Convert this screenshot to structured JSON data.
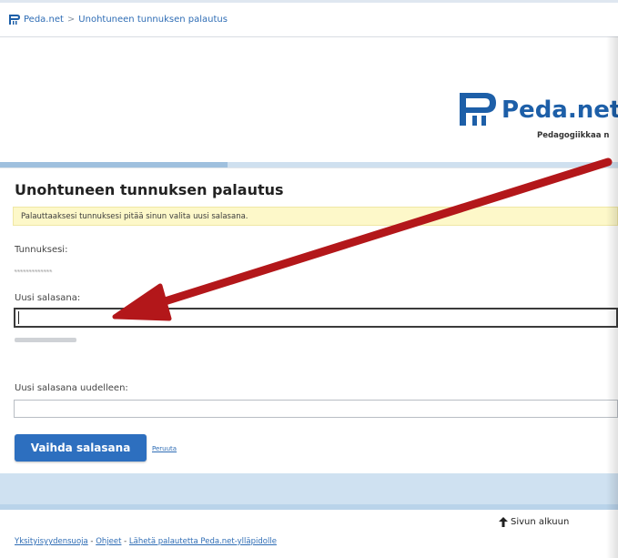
{
  "breadcrumb": {
    "site": "Peda.net",
    "separator": ">",
    "current": "Unohtuneen tunnuksen palautus"
  },
  "logo": {
    "name": "Peda.net",
    "tagline": "Pedagogiikkaa n"
  },
  "form": {
    "title": "Unohtuneen tunnuksen palautus",
    "notice": "Palauttaaksesi tunnuksesi pitää sinun valita uusi salasana.",
    "username_label": "Tunnuksesi:",
    "username_value": "˞˞˞˞˞˞˞˞˞˞˞˞˞",
    "new_password_label": "Uusi salasana:",
    "new_password_value": "",
    "repeat_password_label": "Uusi salasana uudelleen:",
    "repeat_password_value": "",
    "submit_label": "Vaihda salasana",
    "cancel_label": "Peruuta"
  },
  "footer": {
    "to_top": "Sivun alkuun",
    "links": [
      "Yksityisyydensuoja",
      "Ohjeet",
      "Lähetä palautetta Peda.net-ylläpidolle"
    ],
    "link_separator": "-"
  },
  "colors": {
    "brand": "#1d5fa8",
    "button": "#2d6fbf",
    "notice_bg": "#fdf8c9",
    "annotation_arrow": "#b3171a"
  }
}
